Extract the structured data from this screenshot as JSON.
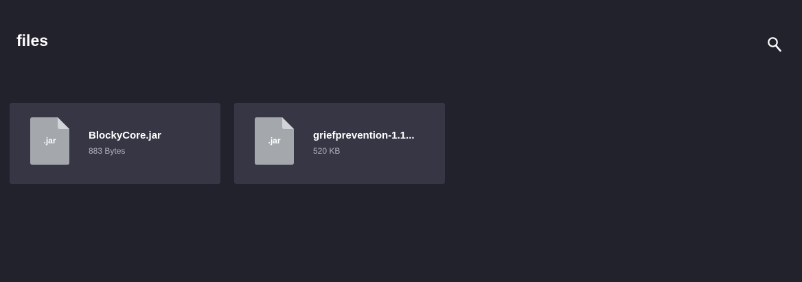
{
  "header": {
    "title": "files",
    "search_icon": "search-icon"
  },
  "files": [
    {
      "ext": ".jar",
      "name": "BlockyCore.jar",
      "size": "883 Bytes",
      "icon": "file-icon"
    },
    {
      "ext": ".jar",
      "name": "griefprevention-1.1...",
      "size": "520 KB",
      "icon": "file-icon"
    }
  ],
  "colors": {
    "background": "#22222c",
    "card": "#363644",
    "file_icon": "#a4a7ac",
    "file_icon_fold": "#d2d4d8"
  }
}
